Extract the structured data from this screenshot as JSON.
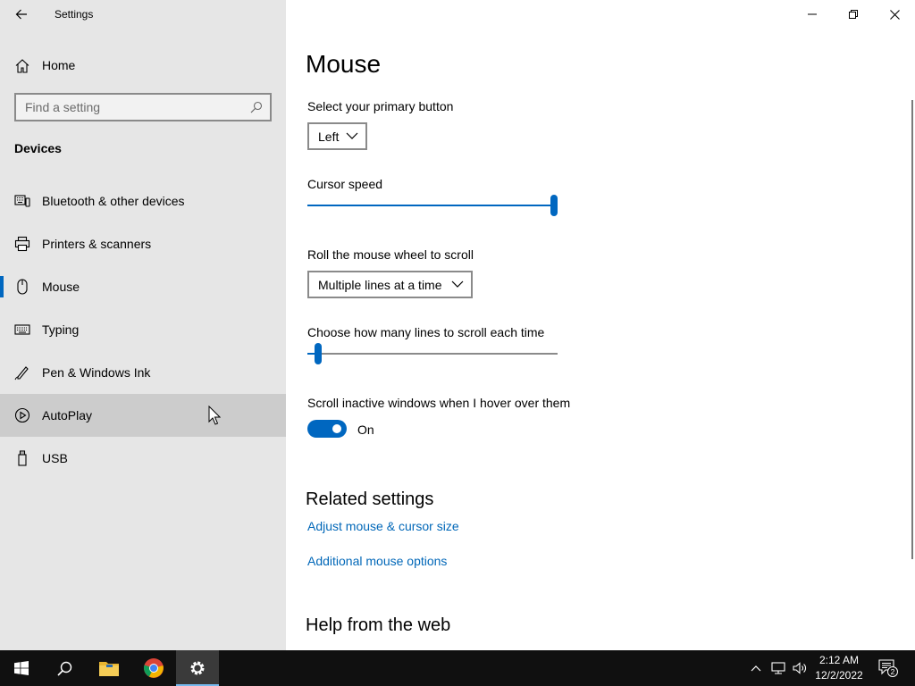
{
  "window": {
    "title": "Settings",
    "back_icon": "back-arrow-icon",
    "controls": [
      "minimize-icon",
      "restore-icon",
      "close-icon"
    ]
  },
  "sidebar": {
    "home_label": "Home",
    "search_placeholder": "Find a setting",
    "section_title": "Devices",
    "items": [
      {
        "label": "Bluetooth & other devices",
        "icon": "bluetooth-devices-icon"
      },
      {
        "label": "Printers & scanners",
        "icon": "printer-icon"
      },
      {
        "label": "Mouse",
        "icon": "mouse-icon",
        "selected": true
      },
      {
        "label": "Typing",
        "icon": "keyboard-icon"
      },
      {
        "label": "Pen & Windows Ink",
        "icon": "pen-icon"
      },
      {
        "label": "AutoPlay",
        "icon": "autoplay-icon",
        "hovered": true
      },
      {
        "label": "USB",
        "icon": "usb-icon"
      }
    ]
  },
  "main": {
    "title": "Mouse",
    "primary_button_label": "Select your primary button",
    "primary_button_value": "Left",
    "cursor_speed_label": "Cursor speed",
    "cursor_speed_level": 1.0,
    "wheel_label": "Roll the mouse wheel to scroll",
    "wheel_value": "Multiple lines at a time",
    "lines_label": "Choose how many lines to scroll each time",
    "lines_level": 0.03,
    "inactive_label": "Scroll inactive windows when I hover over them",
    "inactive_state": "On",
    "related_title": "Related settings",
    "link_cursor_size": "Adjust mouse & cursor size",
    "link_additional": "Additional mouse options",
    "help_title": "Help from the web"
  },
  "taskbar": {
    "time": "2:12 AM",
    "date": "12/2/2022",
    "notification_count": "2"
  },
  "colors": {
    "accent": "#0067c0",
    "link": "#0067b8",
    "sidebar_bg": "#e6e6e6",
    "hover_bg": "#cccccc",
    "taskbar_bg": "#101010"
  }
}
